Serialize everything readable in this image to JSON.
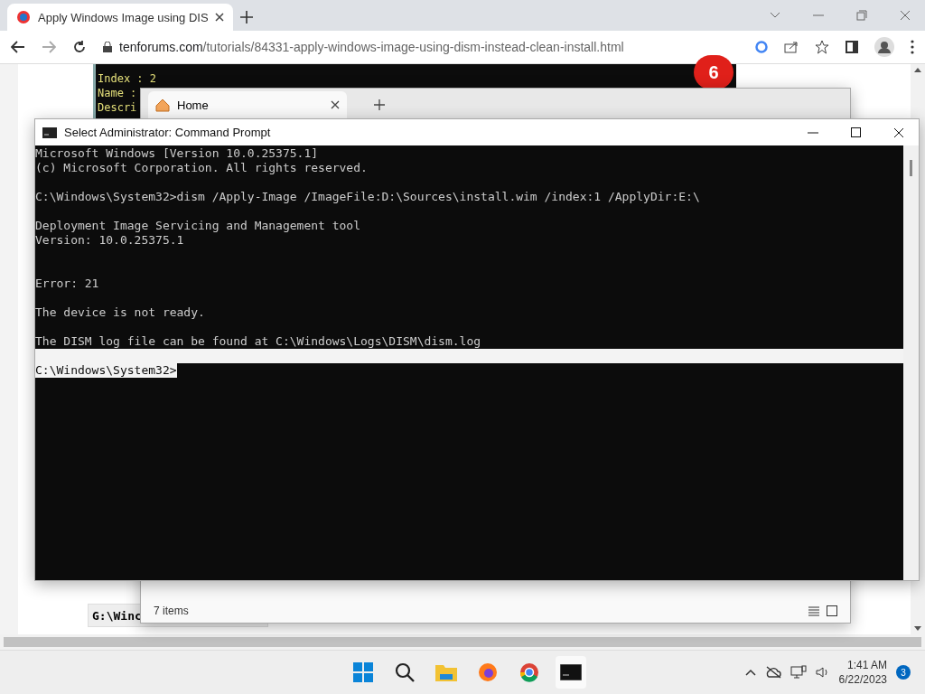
{
  "browser": {
    "tab": {
      "title": "Apply Windows Image using DIS",
      "selected": true
    },
    "url_host": "tenforums.com",
    "url_path": "/tutorials/84331-apply-windows-image-using-dism-instead-clean-install.html"
  },
  "page": {
    "code_top": [
      "Index : 2",
      "Name :",
      "Descri"
    ],
    "step_badge": "6",
    "code_bottom": "G:\\Winc"
  },
  "explorer": {
    "tab": "Home",
    "status": "7 items"
  },
  "console": {
    "title": "Select Administrator:  Command Prompt",
    "lines": [
      {
        "text": "Microsoft Windows [Version 10.0.25375.1]",
        "selected": false
      },
      {
        "text": "(c) Microsoft Corporation. All rights reserved.",
        "selected": false
      },
      {
        "selected": false
      },
      {
        "text": "C:\\Windows\\System32>dism /Apply-Image /ImageFile:D:\\Sources\\install.wim /index:1 /ApplyDir:E:\\",
        "selected": false
      },
      {
        "selected": false
      },
      {
        "text": "Deployment Image Servicing and Management tool",
        "selected": false
      },
      {
        "text": "Version: 10.0.25375.1",
        "selected": false
      },
      {
        "selected": false
      },
      {
        "selected": false
      },
      {
        "text": "Error: 21",
        "selected": false
      },
      {
        "selected": false
      },
      {
        "text": "The device is not ready.",
        "selected": false
      },
      {
        "selected": false
      },
      {
        "text": "The DISM log file can be found at C:\\Windows\\Logs\\DISM\\dism.log",
        "selected": false
      },
      {
        "selected": true
      },
      {
        "text": "C:\\Windows\\System32>",
        "selected": true
      }
    ]
  },
  "taskbar": {
    "time": "1:41 AM",
    "date": "6/22/2023",
    "notifications": "3"
  }
}
